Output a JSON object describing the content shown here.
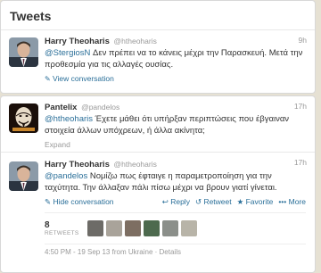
{
  "header": {
    "title": "Tweets"
  },
  "tweet1": {
    "name": "Harry Theoharis",
    "handle": "@htheoharis",
    "time": "9h",
    "mention": "@StergiosN",
    "text": " Δεν πρέπει να το κάνεις μέχρι την Παρασκευή. Μετά την προθεσμία για τις αλλαγές ουσίας.",
    "action": "View conversation"
  },
  "tweet2": {
    "name": "Pantelix",
    "handle": "@pandelos",
    "time": "17h",
    "mention": "@htheoharis",
    "text": " Έχετε μάθει ότι υπήρξαν περιπτώσεις που έβγαιναν στοιχεία άλλων υπόχρεων, ή άλλα ακίνητα;",
    "action": "Expand"
  },
  "tweet3": {
    "name": "Harry Theoharis",
    "handle": "@htheoharis",
    "time": "17h",
    "mention": "@pandelos",
    "text": " Νομίζω πως έφταιγε η παραμετροποίηση για την ταχύτητα. Την άλλαξαν πάλι πίσω μέχρι να βρουν γιατί γίνεται.",
    "hide": "Hide conversation",
    "reply": "Reply",
    "retweet": "Retweet",
    "favorite": "Favorite",
    "more": "More",
    "retweets_count": "8",
    "retweets_label": "RETWEETS",
    "timestamp": "4:50 PM - 19 Sep 13 from Ukraine",
    "details": "Details"
  },
  "colors": {
    "link": "#2a6f99",
    "muted": "#999999",
    "background": "#e6e1d3"
  }
}
